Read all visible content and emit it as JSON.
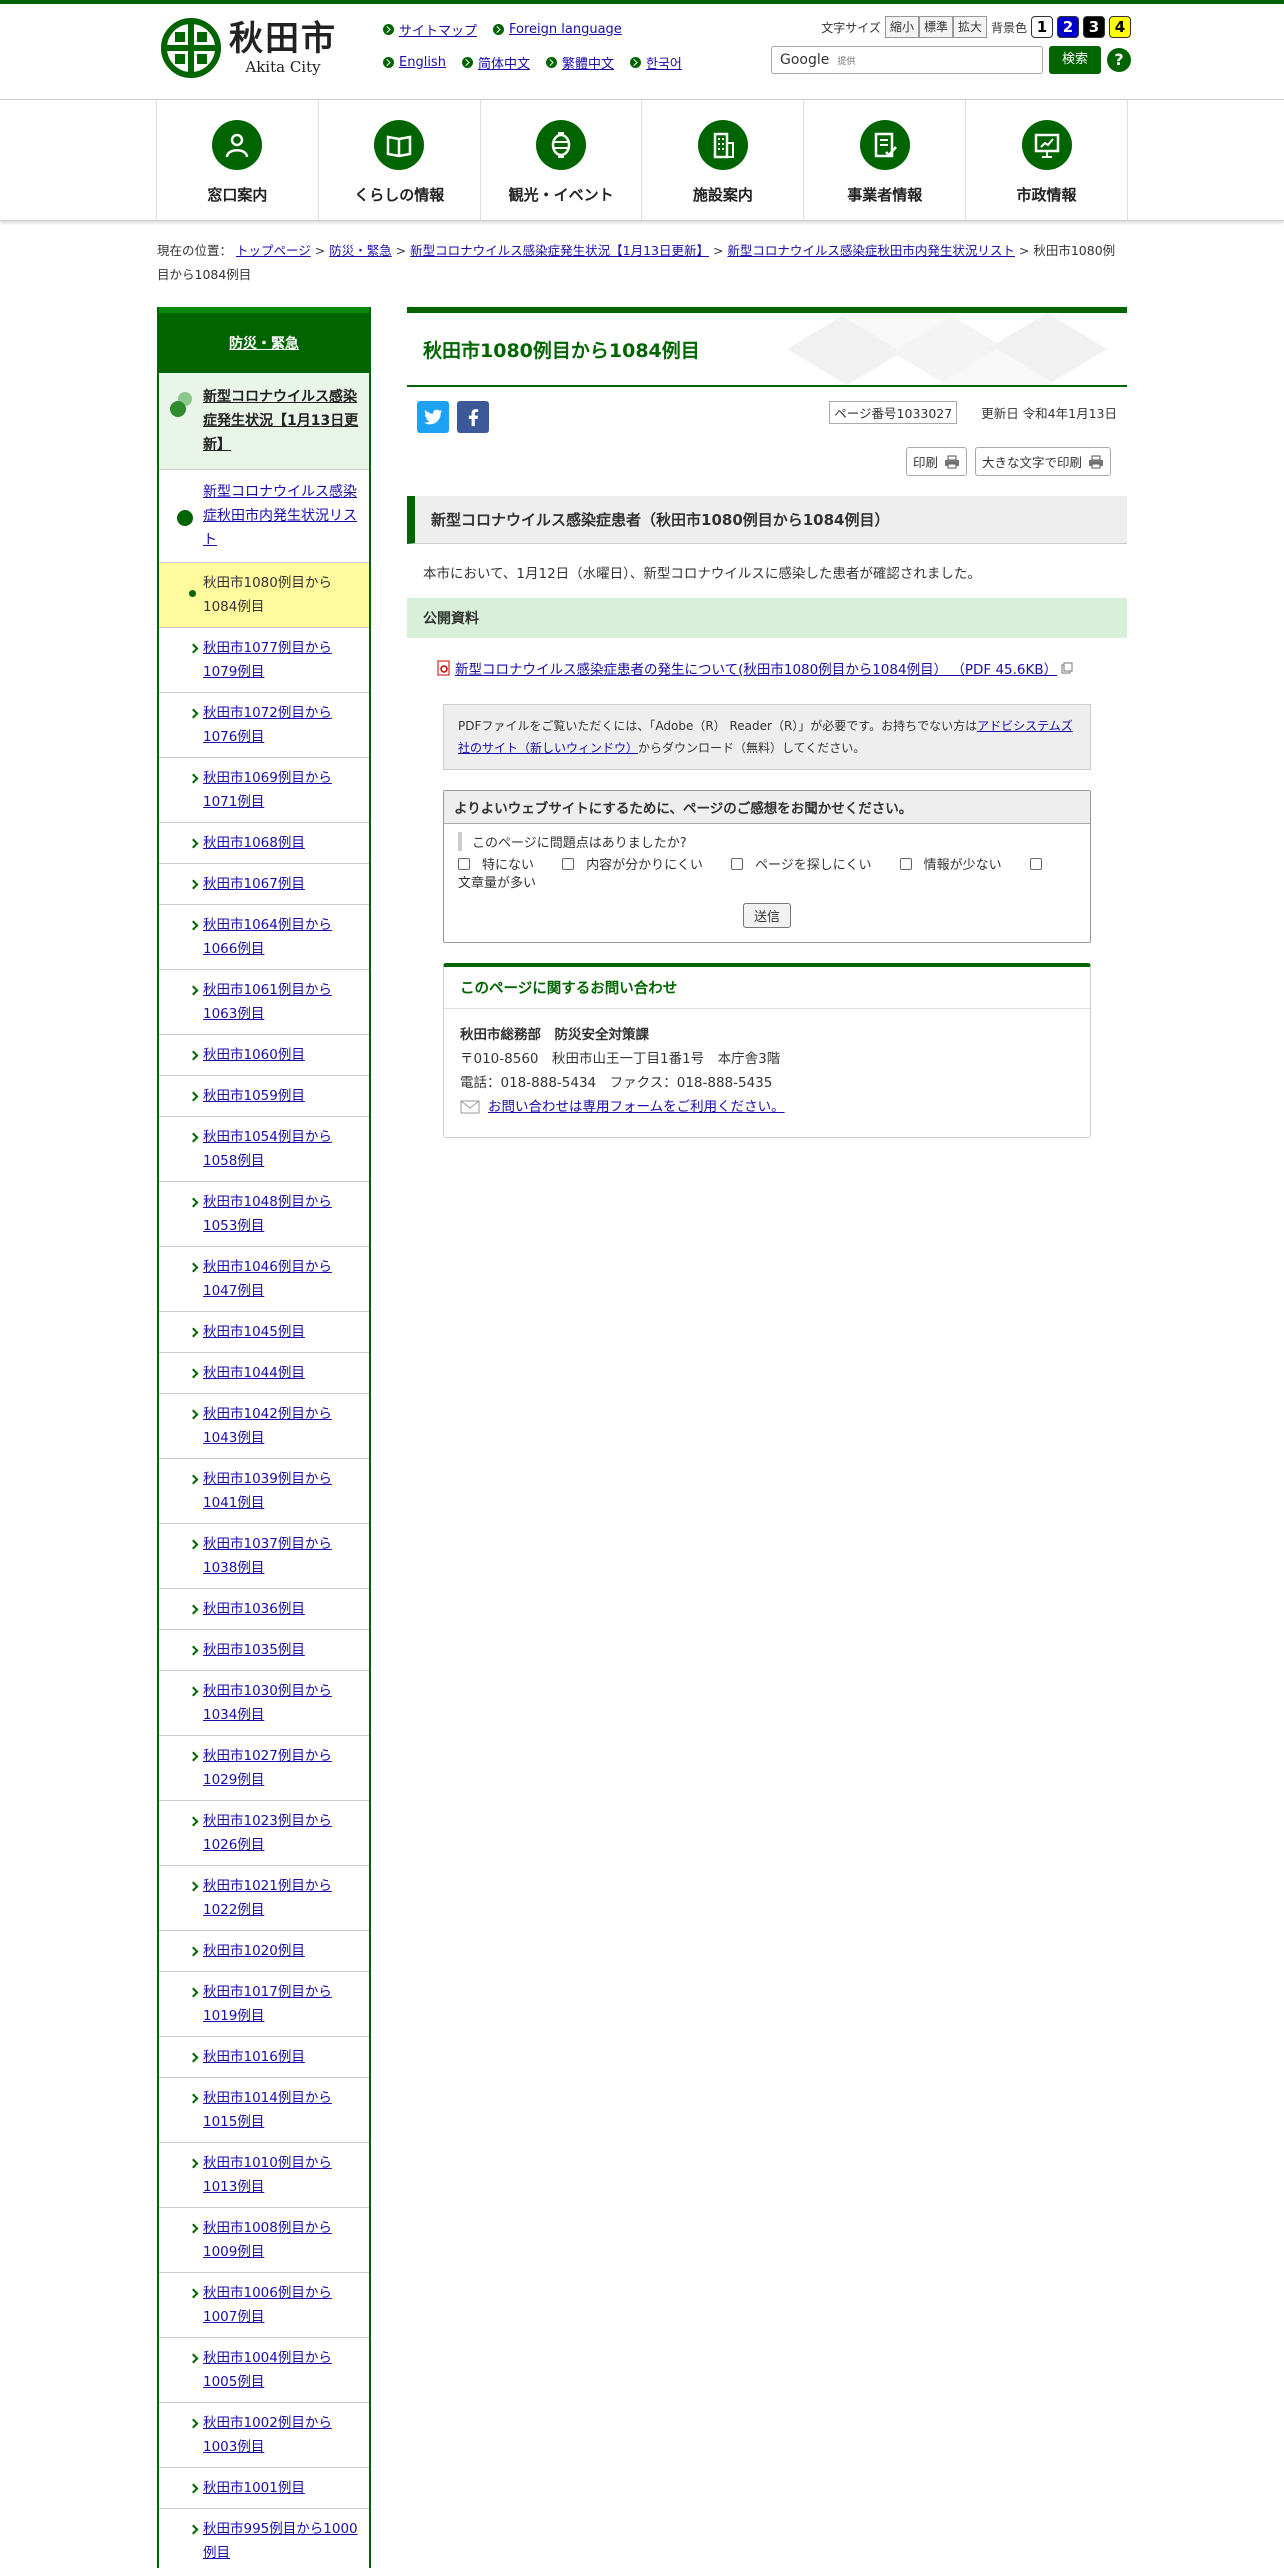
{
  "header": {
    "logo_jp": "秋田市",
    "logo_en": "Akita City",
    "links_row1": [
      "サイトマップ",
      "Foreign language"
    ],
    "links_row2": [
      "English",
      "简体中文",
      "繁體中文",
      "한국어"
    ],
    "fontsize_label": "文字サイズ",
    "fontsize_buttons": [
      "縮小",
      "標準",
      "拡大"
    ],
    "bgcolor_label": "背景色",
    "bgcolor_buttons": [
      "1",
      "2",
      "3",
      "4"
    ],
    "search_brand": "Google",
    "search_sub": "提供",
    "search_button": "検索",
    "help": "?"
  },
  "colors": {
    "accent": "#006400",
    "highlight": "#fffa9e"
  },
  "gnav": [
    {
      "label": "窓口案内",
      "icon": "person-icon"
    },
    {
      "label": "くらしの情報",
      "icon": "book-icon"
    },
    {
      "label": "観光・イベント",
      "icon": "lantern-icon"
    },
    {
      "label": "施設案内",
      "icon": "building-icon"
    },
    {
      "label": "事業者情報",
      "icon": "document-check-icon"
    },
    {
      "label": "市政情報",
      "icon": "presentation-icon"
    }
  ],
  "breadcrumb": {
    "prefix": "現在の位置：",
    "items": [
      "トップページ",
      "防災・緊急",
      "新型コロナウイルス感染症発生状況【1月13日更新】",
      "新型コロナウイルス感染症秋田市内発生状況リスト"
    ],
    "current": "秋田市1080例目から1084例目"
  },
  "sidebar": {
    "head": "防災・緊急",
    "level2": "新型コロナウイルス感染症発生状況【1月13日更新】",
    "level3": "新型コロナウイルス感染症秋田市内発生状況リスト",
    "current": "秋田市1080例目から1084例目",
    "items": [
      "秋田市1077例目から1079例目",
      "秋田市1072例目から1076例目",
      "秋田市1069例目から1071例目",
      "秋田市1068例目",
      "秋田市1067例目",
      "秋田市1064例目から1066例目",
      "秋田市1061例目から1063例目",
      "秋田市1060例目",
      "秋田市1059例目",
      "秋田市1054例目から1058例目",
      "秋田市1048例目から1053例目",
      "秋田市1046例目から1047例目",
      "秋田市1045例目",
      "秋田市1044例目",
      "秋田市1042例目から1043例目",
      "秋田市1039例目から1041例目",
      "秋田市1037例目から1038例目",
      "秋田市1036例目",
      "秋田市1035例目",
      "秋田市1030例目から1034例目",
      "秋田市1027例目から1029例目",
      "秋田市1023例目から1026例目",
      "秋田市1021例目から1022例目",
      "秋田市1020例目",
      "秋田市1017例目から1019例目",
      "秋田市1016例目",
      "秋田市1014例目から1015例目",
      "秋田市1010例目から1013例目",
      "秋田市1008例目から1009例目",
      "秋田市1006例目から1007例目",
      "秋田市1004例目から1005例目",
      "秋田市1002例目から1003例目",
      "秋田市1001例目",
      "秋田市995例目から1000例目"
    ]
  },
  "main": {
    "title": "秋田市1080例目から1084例目",
    "page_no": "ページ番号1033027",
    "updated": "更新日 令和4年1月13日",
    "print": "印刷",
    "print_large": "大きな文字で印刷",
    "h2": "新型コロナウイルス感染症患者（秋田市1080例目から1084例目）",
    "lead": "本市において、1月12日（水曜日）、新型コロナウイルスに感染した患者が確認されました。",
    "h3": "公開資料",
    "pdf_link": "新型コロナウイルス感染症患者の発生について(秋田市1080例目から1084例目） （PDF 45.6KB）",
    "pdf_note_pre": "PDFファイルをご覧いただくには、「Adobe（R） Reader（R）」が必要です。お持ちでない方は",
    "pdf_note_link": "アドビシステムズ社のサイト（新しいウィンドウ）",
    "pdf_note_post": "からダウンロード（無料）してください。"
  },
  "survey": {
    "title": "よりよいウェブサイトにするために、ページのご感想をお聞かせください。",
    "question": "このページに問題点はありましたか?",
    "options": [
      "特にない",
      "内容が分かりにくい",
      "ページを探しにくい",
      "情報が少ない",
      "文章量が多い"
    ],
    "submit": "送信"
  },
  "contact": {
    "title": "このページに関するお問い合わせ",
    "dept": "秋田市総務部　防災安全対策課",
    "address": "〒010-8560　秋田市山王一丁目1番1号　本庁舎3階",
    "phone": "電話：018-888-5434　ファクス：018-888-5435",
    "form_link": "お問い合わせは専用フォームをご利用ください。"
  }
}
